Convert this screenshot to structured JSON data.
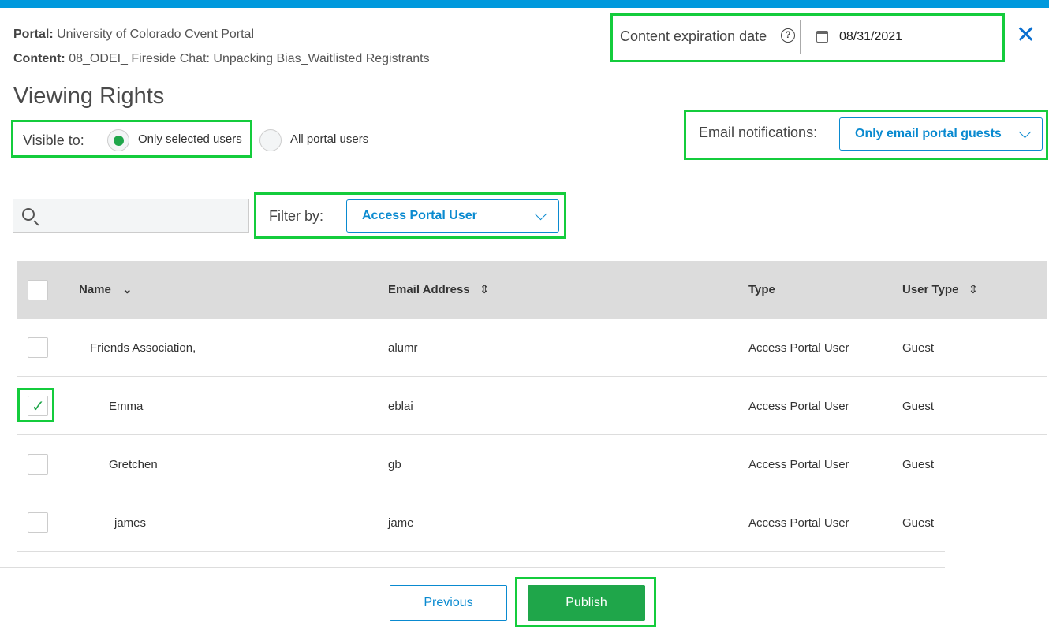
{
  "header": {
    "portal_label": "Portal:",
    "portal_value": "University of Colorado Cvent Portal",
    "content_label": "Content:",
    "content_value": "08_ODEI_ Fireside Chat: Unpacking Bias_Waitlisted Registrants",
    "expiration_label": "Content expiration date",
    "expiration_date": "08/31/2021"
  },
  "title": "Viewing Rights",
  "visibility": {
    "label": "Visible to:",
    "options": [
      {
        "label": "Only selected users",
        "selected": true
      },
      {
        "label": "All portal users",
        "selected": false
      }
    ]
  },
  "email_notifications": {
    "label": "Email notifications:",
    "value": "Only email portal guests"
  },
  "search": {
    "placeholder": ""
  },
  "filter": {
    "label": "Filter by:",
    "value": "Access Portal User"
  },
  "table": {
    "columns": [
      "Name",
      "Email Address",
      "Type",
      "User Type"
    ],
    "rows": [
      {
        "name": "Friends Association,",
        "email": "alumr",
        "type": "Access Portal User",
        "user_type": "Guest",
        "checked": false
      },
      {
        "name": "Emma",
        "email": "eblai",
        "type": "Access Portal User",
        "user_type": "Guest",
        "checked": true
      },
      {
        "name": "Gretchen",
        "email": "gb",
        "type": "Access Portal User",
        "user_type": "Guest",
        "checked": false
      },
      {
        "name": "james",
        "email": "jame",
        "type": "Access Portal User",
        "user_type": "Guest",
        "checked": false
      }
    ]
  },
  "buttons": {
    "previous": "Previous",
    "publish": "Publish"
  },
  "colors": {
    "accent": "#0099dd",
    "primary_button": "#1fa64a",
    "link": "#0a8ad0",
    "highlight": "#14cc3c"
  }
}
